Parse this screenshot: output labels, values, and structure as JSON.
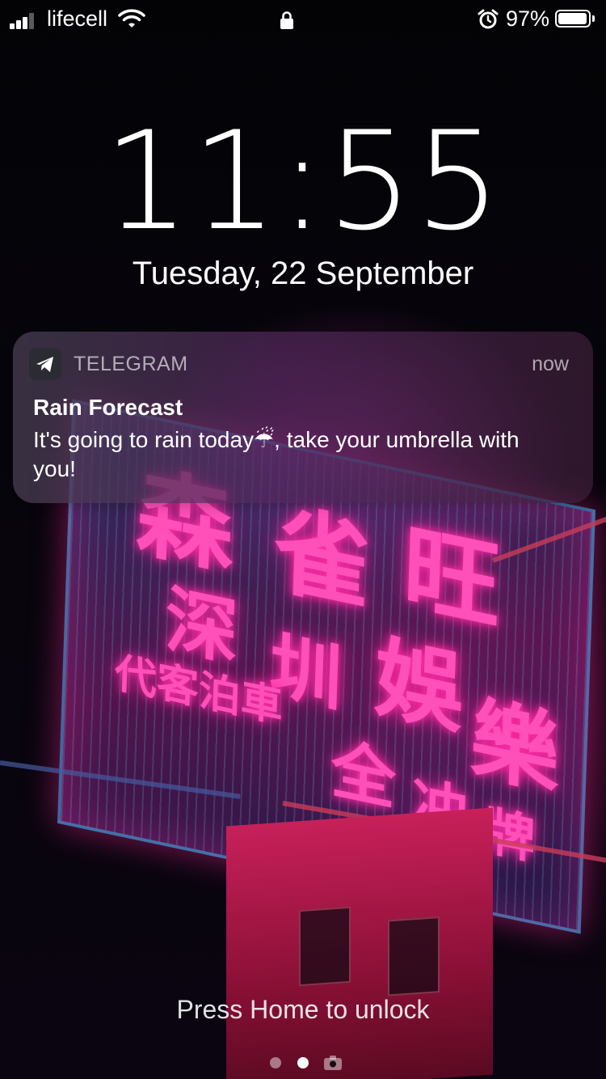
{
  "status_bar": {
    "carrier": "lifecell",
    "battery_percent_label": "97%",
    "battery_level": 0.97,
    "signal_bars": 3,
    "icons": [
      "signal-icon",
      "wifi-icon",
      "lock-icon",
      "alarm-icon",
      "battery-icon"
    ]
  },
  "lock_screen": {
    "time": "11:55",
    "date": "Tuesday, 22 September",
    "unlock_hint": "Press Home to unlock",
    "page_indicator": {
      "pages": 2,
      "current": 2,
      "trailing_icon": "camera-icon"
    }
  },
  "notification": {
    "app_name": "TELEGRAM",
    "time": "now",
    "title": "Rain Forecast",
    "body": "It's going to rain today☔, take your umbrella with you!",
    "app_icon": "telegram-icon"
  },
  "colors": {
    "neon_pink": "#ff4fb8",
    "notification_bg": "#4a3a52"
  }
}
